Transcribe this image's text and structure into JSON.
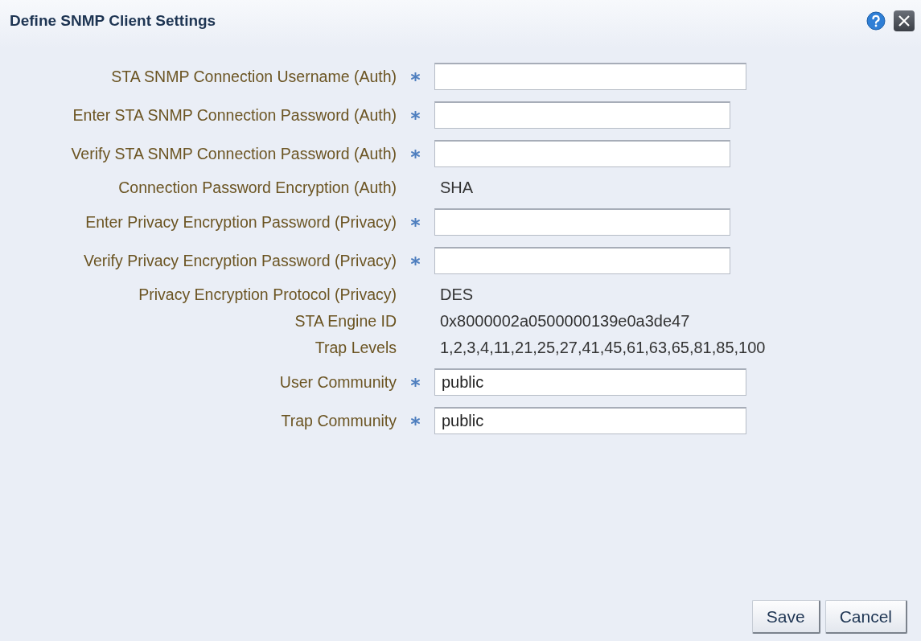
{
  "dialog": {
    "title": "Define SNMP Client Settings"
  },
  "fields": [
    {
      "kind": "text",
      "label": "STA SNMP Connection Username (Auth)",
      "required": true
    },
    {
      "kind": "password",
      "label": "Enter STA SNMP Connection Password (Auth)",
      "required": true
    },
    {
      "kind": "password",
      "label": "Verify STA SNMP Connection Password (Auth)",
      "required": true
    },
    {
      "kind": "readonly",
      "label": "Connection Password Encryption (Auth)",
      "required": false,
      "value": "SHA"
    },
    {
      "kind": "password",
      "label": "Enter Privacy Encryption Password (Privacy)",
      "required": true
    },
    {
      "kind": "password",
      "label": "Verify Privacy Encryption Password (Privacy)",
      "required": true
    },
    {
      "kind": "readonly",
      "label": "Privacy Encryption Protocol (Privacy)",
      "required": false,
      "value": "DES"
    },
    {
      "kind": "readonly",
      "label": "STA Engine ID",
      "required": false,
      "value": "0x8000002a0500000139e0a3de47"
    },
    {
      "kind": "readonly",
      "label": "Trap Levels",
      "required": false,
      "value": "1,2,3,4,11,21,25,27,41,45,61,63,65,81,85,100"
    },
    {
      "kind": "text",
      "label": "User Community",
      "required": true,
      "value": "public"
    },
    {
      "kind": "text",
      "label": "Trap Community",
      "required": true,
      "value": "public"
    }
  ],
  "buttons": [
    "Save",
    "Cancel"
  ]
}
